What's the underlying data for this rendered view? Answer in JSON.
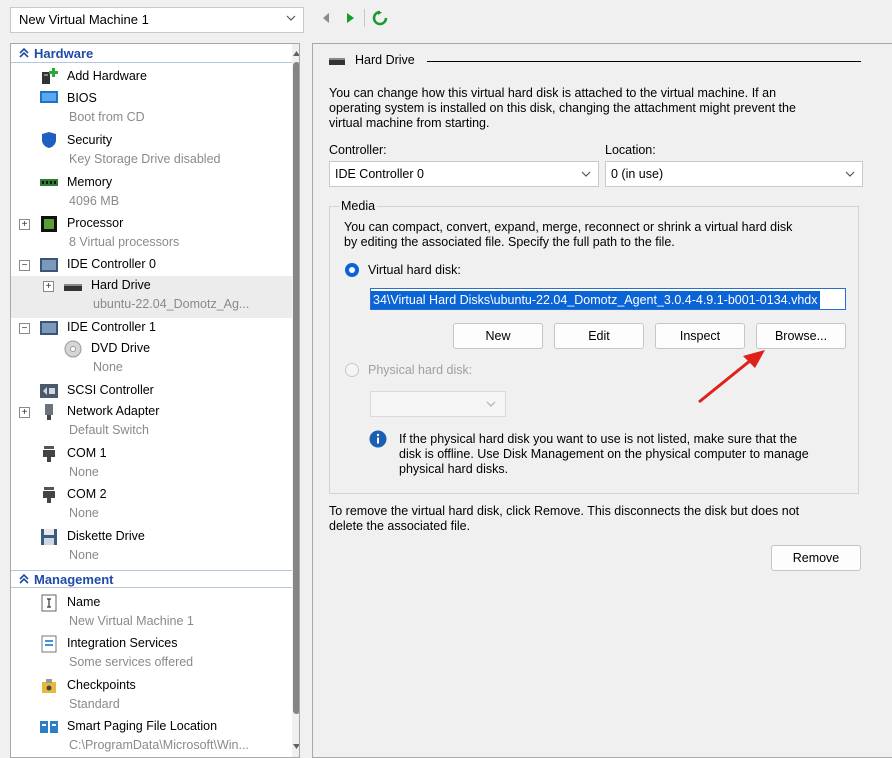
{
  "vm_selector": {
    "value": "New Virtual Machine 1"
  },
  "toolbar": {
    "back": "back-arrow",
    "start": "start",
    "refresh": "refresh"
  },
  "tree": {
    "hardware_header": "Hardware",
    "management_header": "Management",
    "items": {
      "add_hardware": {
        "label": "Add Hardware"
      },
      "bios": {
        "label": "BIOS",
        "sub": "Boot from CD"
      },
      "security": {
        "label": "Security",
        "sub": "Key Storage Drive disabled"
      },
      "memory": {
        "label": "Memory",
        "sub": "4096 MB"
      },
      "processor": {
        "label": "Processor",
        "sub": "8 Virtual processors"
      },
      "ide0": {
        "label": "IDE Controller 0"
      },
      "hard_drive": {
        "label": "Hard Drive",
        "sub": "ubuntu-22.04_Domotz_Ag..."
      },
      "ide1": {
        "label": "IDE Controller 1"
      },
      "dvd": {
        "label": "DVD Drive",
        "sub": "None"
      },
      "scsi": {
        "label": "SCSI Controller"
      },
      "network": {
        "label": "Network Adapter",
        "sub": "Default Switch"
      },
      "com1": {
        "label": "COM 1",
        "sub": "None"
      },
      "com2": {
        "label": "COM 2",
        "sub": "None"
      },
      "diskette": {
        "label": "Diskette Drive",
        "sub": "None"
      },
      "name": {
        "label": "Name",
        "sub": "New Virtual Machine 1"
      },
      "integration": {
        "label": "Integration Services",
        "sub": "Some services offered"
      },
      "checkpoints": {
        "label": "Checkpoints",
        "sub": "Standard"
      },
      "smart_paging": {
        "label": "Smart Paging File Location",
        "sub": "C:\\ProgramData\\Microsoft\\Win..."
      }
    }
  },
  "panel": {
    "title": "Hard Drive",
    "intro_line1": "You can change how this virtual hard disk is attached to the virtual machine. If an",
    "intro_line2": "operating system is installed on this disk, changing the attachment might prevent the",
    "intro_line3": "virtual machine from starting.",
    "controller_label": "Controller:",
    "controller_value": "IDE Controller 0",
    "location_label": "Location:",
    "location_value": "0 (in use)",
    "media_title": "Media",
    "media_line1": "You can compact, convert, expand, merge, reconnect or shrink a virtual hard disk",
    "media_line2": "by editing the associated file. Specify the full path to the file.",
    "vhd_radio_label": "Virtual hard disk:",
    "vhd_path": "34\\Virtual Hard Disks\\ubuntu-22.04_Domotz_Agent_3.0.4-4.9.1-b001-0134.vhdx",
    "buttons": {
      "new": "New",
      "edit": "Edit",
      "inspect": "Inspect",
      "browse": "Browse..."
    },
    "physical_radio_label": "Physical hard disk:",
    "info_line1": "If the physical hard disk you want to use is not listed, make sure that the",
    "info_line2": "disk is offline. Use Disk Management on the physical computer to manage",
    "info_line3": "physical hard disks.",
    "remove_line1": "To remove the virtual hard disk, click Remove. This disconnects the disk but does not",
    "remove_line2": "delete the associated file.",
    "remove_button": "Remove"
  },
  "colors": {
    "accent": "#0a64d6",
    "header_blue": "#1f4aa8",
    "annotation_red": "#e0201b"
  }
}
